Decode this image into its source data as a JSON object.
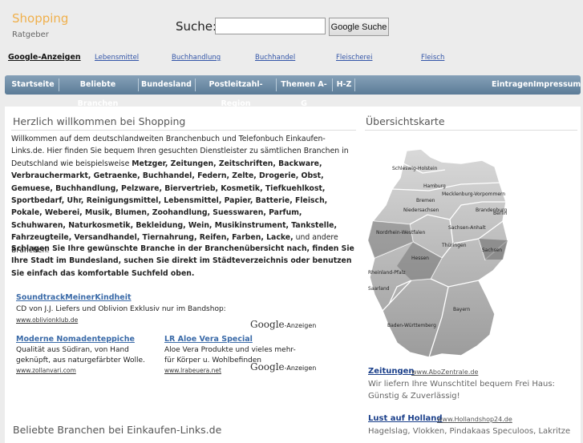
{
  "header": {
    "logo": "Shopping",
    "logo_sub": "Ratgeber",
    "search_label": "Suche:",
    "search_value": "",
    "search_button": "Google Suche"
  },
  "ad_links": {
    "title": "Google-Anzeigen",
    "items": [
      "Lebensmittel",
      "Buchhandlung",
      "Buchhandel",
      "Fleischerei",
      "Fleisch"
    ]
  },
  "nav": {
    "items": [
      "Startseite",
      "Beliebte Branchen",
      "Bundesland",
      "Postleitzahl-Region",
      "Themen A-G",
      "H-Z"
    ],
    "right": [
      "Eintragen",
      "Impressum"
    ]
  },
  "main": {
    "title": "Herzlich willkommen bei Shopping",
    "intro_lead": "Willkommen auf dem deutschlandweiten Branchenbuch und Telefonbuch Einkaufen-Links.de. Hier finden Sie bequem Ihren gesuchten Dienstleister zu sämtlichen Branchen in Deutschland wie beispielsweise ",
    "intro_branches": "Metzger, Zeitungen, Zeitschriften, Backware, Verbrauchermarkt, Getraenke, Buchhandel, Federn, Zelte, Drogerie, Obst, Gemuese, Buchhandlung, Pelzware, Biervertrieb, Kosmetik, Tiefkuehlkost, Sportbedarf, Uhr, Reinigungsmittel, Lebensmittel, Papier, Batterie, Fleisch, Pokale, Weberei, Musik, Blumen, Zoohandlung, Suesswaren, Parfum, Schuhwaren, Naturkosmetik, Bekleidung, Wein, Musikinstrument, Tankstelle, Fahrzeugteile, Versandhandel, Tiernahrung, Reifen, Farben, Lacke,",
    "intro_tail": " und andere Branchen.",
    "bold_paragraph": "Schlagen Sie Ihre gewünschte Branche in der Branchenübersicht nach, finden Sie Ihre Stadt im Bundesland, suchen Sie direkt im Städteverzeichnis oder benutzen Sie einfach das komfortable Suchfeld oben.",
    "ads": [
      {
        "title": "SoundtrackMeinerKindheit",
        "text": "CD von J.J. Liefers und Oblivion Exklusiv nur im Bandshop:",
        "url": "www.oblivionklub.de"
      },
      {
        "title": "Moderne Nomadenteppiche",
        "text": "Qualität aus Südiran, von Hand geknüpft, aus naturgefärbter Wolle.",
        "url": "www.zollanvari.com"
      },
      {
        "title": "LR Aloe Vera Special",
        "text": "Aloe Vera Produkte und vieles mehr- für Körper u. Wohlbefinden",
        "url": "www.lrabeuera.net"
      }
    ],
    "google_ads_label": "Google",
    "google_ads_suffix": "-Anzeigen",
    "section2_title": "Beliebte Branchen bei Einkaufen-Links.de"
  },
  "sidebar": {
    "title": "Übersichtskarte",
    "map_labels": [
      "Schleswig-Holstein",
      "Mecklenburg-Vorpommern",
      "Hamburg",
      "Bremen",
      "Niedersachsen",
      "Brandenburg",
      "Berlin",
      "Sachsen-Anhalt",
      "Nordrhein-Westfalen",
      "Thüringen",
      "Sachsen",
      "Hessen",
      "Rheinland-Pfalz",
      "Saarland",
      "Bayern",
      "Baden-Württemberg"
    ],
    "ads": [
      {
        "title": "Zeitungen",
        "url": "www.AboZentrale.de",
        "text": "Wir liefern Ihre Wunschtitel bequem Frei Haus: Günstig & Zuverlässig!"
      },
      {
        "title": "Lust auf Holland",
        "url": "www.Hollandshop24.de",
        "text": "Hagelslag, Vlokken, Pindakaas Speculoos, Lakritze"
      }
    ]
  },
  "colors": {
    "logo": "#f0b04c",
    "nav_bg": "#6b89a4",
    "link": "#1a3f8a",
    "ad_title": "#3a6aa8"
  }
}
